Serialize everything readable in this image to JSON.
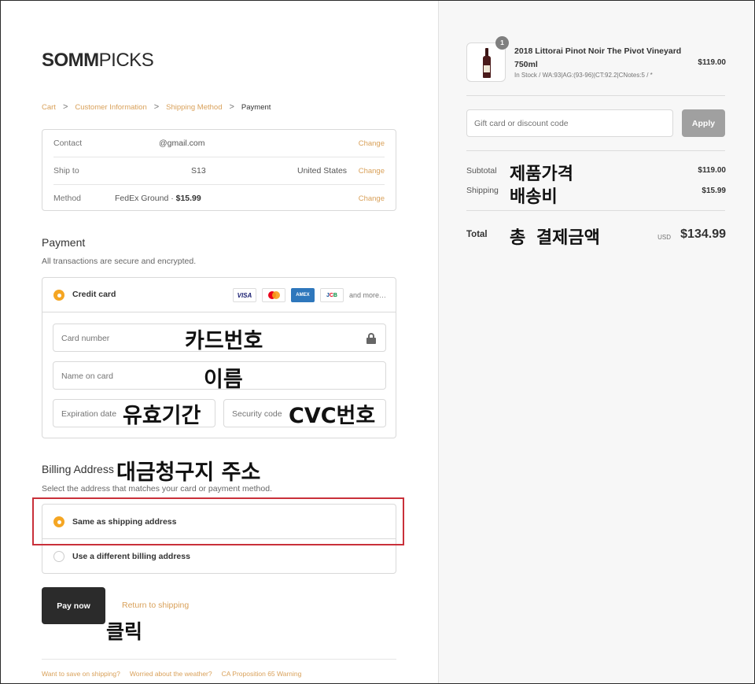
{
  "logo": {
    "bold": "SOMM",
    "light": "PICKS"
  },
  "breadcrumb": {
    "cart": "Cart",
    "info": "Customer Information",
    "shipping": "Shipping Method",
    "payment": "Payment",
    "separator": ">"
  },
  "info": {
    "contact_label": "Contact",
    "contact_value": "@gmail.com",
    "shipto_label": "Ship to",
    "shipto_value": "S13",
    "shipto_country": "United States",
    "method_label": "Method",
    "method_value": "FedEx Ground · ",
    "method_price": "$15.99",
    "change": "Change"
  },
  "payment": {
    "title": "Payment",
    "subtitle": "All transactions are secure and encrypted.",
    "option_label": "Credit card",
    "cards": {
      "visa": "VISA",
      "amex": "AMEX",
      "jcb": [
        "J",
        "C",
        "B"
      ],
      "more": "and more…"
    },
    "card_number_ph": "Card number",
    "name_ph": "Name on card",
    "expiry_ph": "Expiration date",
    "security_ph": "Security code"
  },
  "billing": {
    "title": "Billing Address",
    "subtitle": "Select the address that matches your card or payment method.",
    "same": "Same as shipping address",
    "different": "Use a different billing address"
  },
  "actions": {
    "pay_now": "Pay now",
    "return": "Return to shipping"
  },
  "footer": {
    "links": [
      "Want to save on shipping?",
      "Worried about the weather?",
      "CA Proposition 65 Warning"
    ]
  },
  "annotations": {
    "card_number": "카드번호",
    "name": "이름",
    "expiry": "유효기간",
    "cvc": "CVC번호",
    "billing": "대금청구지 주소",
    "click": "클릭",
    "subtotal": "제품가격",
    "shipping": "배송비",
    "total": "총 결제금액"
  },
  "order": {
    "quantity": "1",
    "product_name": "2018 Littorai Pinot Noir The Pivot Vineyard 750ml",
    "product_meta": "In Stock / WA:93|AG:(93-96)|CT:92.2|CNotes:5 / *",
    "product_price": "$119.00",
    "gift_ph": "Gift card or discount code",
    "apply": "Apply",
    "subtotal_label": "Subtotal",
    "subtotal_value": "$119.00",
    "shipping_label": "Shipping",
    "shipping_value": "$15.99",
    "total_label": "Total",
    "total_currency": "USD",
    "total_value": "$134.99"
  },
  "colors": {
    "accent": "#f5a623",
    "link": "#d9a15a",
    "button": "#2b2b2b",
    "highlight": "#c9303a"
  }
}
